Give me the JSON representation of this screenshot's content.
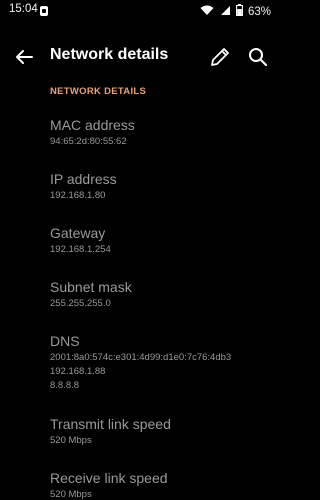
{
  "status_bar": {
    "time": "15:04",
    "battery": "63%",
    "icons": [
      "notification-icon",
      "wifi-icon",
      "signal-icon",
      "battery-icon"
    ]
  },
  "app_bar": {
    "title": "Network details",
    "icons": [
      "back-arrow-icon",
      "pencil-icon",
      "search-icon"
    ]
  },
  "section_header": "NETWORK DETAILS",
  "colors": {
    "accent": "#e8a27c",
    "background": "#000000",
    "secondary_text": "#9a9a9a"
  },
  "items": [
    {
      "label": "MAC address",
      "values": [
        "94:65:2d:80:55:62"
      ]
    },
    {
      "label": "IP address",
      "values": [
        "192.168.1.80"
      ]
    },
    {
      "label": "Gateway",
      "values": [
        "192.168.1.254"
      ]
    },
    {
      "label": "Subnet mask",
      "values": [
        "255.255.255.0"
      ]
    },
    {
      "label": "DNS",
      "values": [
        "2001:8a0:574c:e301:4d99:d1e0:7c76:4db3",
        "192.168.1.88",
        "8.8.8.8"
      ]
    },
    {
      "label": "Transmit link speed",
      "values": [
        "520 Mbps"
      ]
    },
    {
      "label": "Receive link speed",
      "values": [
        "520 Mbps"
      ]
    }
  ]
}
